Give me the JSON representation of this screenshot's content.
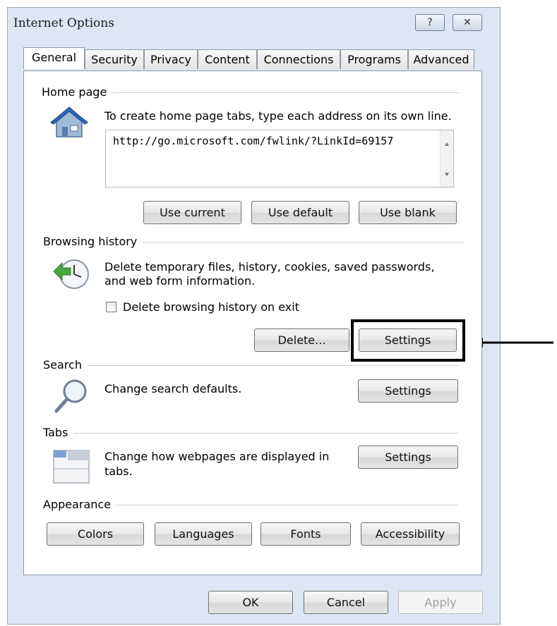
{
  "window": {
    "title": "Internet Options",
    "help_icon": "?",
    "close_icon": "✕"
  },
  "tabs": [
    {
      "label": "General",
      "active": true
    },
    {
      "label": "Security",
      "active": false
    },
    {
      "label": "Privacy",
      "active": false
    },
    {
      "label": "Content",
      "active": false
    },
    {
      "label": "Connections",
      "active": false
    },
    {
      "label": "Programs",
      "active": false
    },
    {
      "label": "Advanced",
      "active": false
    }
  ],
  "home_page": {
    "group_label": "Home page",
    "instruction": "To create home page tabs, type each address on its own line.",
    "url_value": "http://go.microsoft.com/fwlink/?LinkId=69157",
    "use_current": "Use current",
    "use_default": "Use default",
    "use_blank": "Use blank"
  },
  "browsing_history": {
    "group_label": "Browsing history",
    "description_line1": "Delete temporary files, history, cookies, saved passwords,",
    "description_line2": "and web form information.",
    "checkbox_label": "Delete browsing history on exit",
    "checkbox_checked": false,
    "delete_button": "Delete...",
    "settings_button": "Settings"
  },
  "search": {
    "group_label": "Search",
    "description": "Change search defaults.",
    "settings_button": "Settings"
  },
  "tabs_section": {
    "group_label": "Tabs",
    "description_line1": "Change how webpages are displayed in",
    "description_line2": "tabs.",
    "settings_button": "Settings"
  },
  "appearance": {
    "group_label": "Appearance",
    "colors": "Colors",
    "languages": "Languages",
    "fonts": "Fonts",
    "accessibility": "Accessibility"
  },
  "footer": {
    "ok": "OK",
    "cancel": "Cancel",
    "apply": "Apply"
  },
  "colors": {
    "window_bg": "#dde6f2",
    "highlight": "#000000"
  }
}
